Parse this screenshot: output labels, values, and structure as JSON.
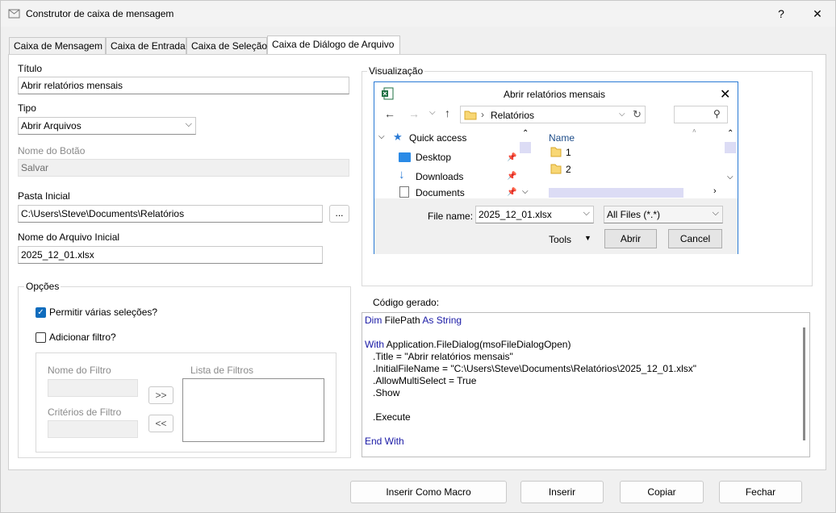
{
  "window": {
    "title": "Construtor de caixa de mensagem",
    "help": "?",
    "close": "✕"
  },
  "tabs": [
    {
      "label": "Caixa de Mensagem"
    },
    {
      "label": "Caixa de Entrada"
    },
    {
      "label": "Caixa de Seleção"
    },
    {
      "label": "Caixa de Diálogo de Arquivo"
    }
  ],
  "form": {
    "titulo_label": "Título",
    "titulo_value": "Abrir relatórios mensais",
    "tipo_label": "Tipo",
    "tipo_value": "Abrir Arquivos",
    "botao_label": "Nome do Botão",
    "botao_value": "Salvar",
    "pasta_label": "Pasta Inicial",
    "pasta_value": "C:\\Users\\Steve\\Documents\\Relatórios",
    "browse_label": "...",
    "arquivo_label": "Nome do Arquivo Inicial",
    "arquivo_value": "2025_12_01.xlsx"
  },
  "opcoes": {
    "label": "Opções",
    "multi_label": "Permitir várias seleções?",
    "filtro_label": "Adicionar filtro?",
    "nome_filtro_label": "Nome do Filtro",
    "criterios_label": "Critérios de Filtro",
    "lista_label": "Lista de Filtros",
    "add_btn": ">>",
    "remove_btn": "<<"
  },
  "preview": {
    "label": "Visualização",
    "dialog_title": "Abrir relatórios mensais",
    "breadcrumb": "Relatórios",
    "nav": {
      "quick_access": "Quick access",
      "desktop": "Desktop",
      "downloads": "Downloads",
      "documents": "Documents"
    },
    "column_name": "Name",
    "files": [
      "1",
      "2"
    ],
    "file_name_label": "File name:",
    "file_name_value": "2025_12_01.xlsx",
    "filter_value": "All Files (*.*)",
    "tools_label": "Tools",
    "open_btn": "Abrir",
    "cancel_btn": "Cancel"
  },
  "code": {
    "label": "Código gerado:",
    "lines": [
      {
        "kw": "Dim ",
        "text": "FilePath ",
        "kw2": "As String"
      },
      {
        "kw": "",
        "text": "",
        "kw2": ""
      },
      {
        "kw": "With ",
        "text": "Application.FileDialog(msoFileDialogOpen)",
        "kw2": ""
      },
      {
        "kw": "",
        "text": "   .Title = \"Abrir relatórios mensais\"",
        "kw2": ""
      },
      {
        "kw": "",
        "text": "   .InitialFileName = \"C:\\Users\\Steve\\Documents\\Relatórios\\2025_12_01.xlsx\"",
        "kw2": ""
      },
      {
        "kw": "",
        "text": "   .AllowMultiSelect = True",
        "kw2": ""
      },
      {
        "kw": "",
        "text": "   .Show",
        "kw2": ""
      },
      {
        "kw": "",
        "text": "",
        "kw2": ""
      },
      {
        "kw": "",
        "text": "   .Execute",
        "kw2": ""
      },
      {
        "kw": "",
        "text": "",
        "kw2": ""
      },
      {
        "kw": "End With",
        "text": "",
        "kw2": ""
      }
    ]
  },
  "footer": {
    "macro_btn": "Inserir Como Macro",
    "insert_btn": "Inserir",
    "copy_btn": "Copiar",
    "close_btn": "Fechar"
  },
  "colors": {
    "accent": "#0f6cbd",
    "keyword": "#1a1aa6",
    "preview_border": "#2a7ad5"
  }
}
